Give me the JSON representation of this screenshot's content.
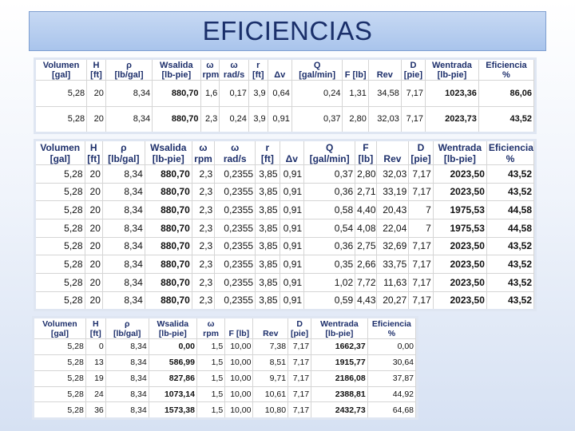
{
  "title": "EFICIENCIAS",
  "table1": {
    "head1": [
      "Volumen",
      "H",
      "ρ",
      "Wsalida",
      "ω",
      "ω",
      "r",
      "",
      "Q",
      "",
      "",
      "D",
      "Wentrada",
      "Eficiencia"
    ],
    "head2": [
      "[gal]",
      "[ft]",
      "[lb/gal]",
      "[lb-pie]",
      "rpm",
      "rad/s",
      "[ft]",
      "Δv",
      "[gal/min]",
      "F [lb]",
      "Rev",
      "[pie]",
      "[lb-pie]",
      "%"
    ],
    "rows": [
      [
        "5,28",
        "20",
        "8,34",
        "880,70",
        "1,6",
        "0,17",
        "3,9",
        "0,64",
        "0,24",
        "1,31",
        "34,58",
        "7,17",
        "1023,36",
        "86,06"
      ],
      [
        "5,28",
        "20",
        "8,34",
        "880,70",
        "2,3",
        "0,24",
        "3,9",
        "0,91",
        "0,37",
        "2,80",
        "32,03",
        "7,17",
        "2023,73",
        "43,52"
      ]
    ]
  },
  "table2": {
    "head1": [
      "Volumen",
      "H",
      "ρ",
      "Wsalida",
      "ω",
      "ω",
      "r",
      "",
      "Q",
      "F",
      "",
      "D",
      "Wentrada",
      "Eficiencia"
    ],
    "head2": [
      "[gal]",
      "[ft]",
      "[lb/gal]",
      "[lb-pie]",
      "rpm",
      "rad/s",
      "[ft]",
      "Δv",
      "[gal/min]",
      "[lb]",
      "Rev",
      "[pie]",
      "[lb-pie]",
      "%"
    ],
    "rows": [
      [
        "5,28",
        "20",
        "8,34",
        "880,70",
        "2,3",
        "0,2355",
        "3,85",
        "0,91",
        "0,37",
        "2,80",
        "32,03",
        "7,17",
        "2023,50",
        "43,52"
      ],
      [
        "5,28",
        "20",
        "8,34",
        "880,70",
        "2,3",
        "0,2355",
        "3,85",
        "0,91",
        "0,36",
        "2,71",
        "33,19",
        "7,17",
        "2023,50",
        "43,52"
      ],
      [
        "5,28",
        "20",
        "8,34",
        "880,70",
        "2,3",
        "0,2355",
        "3,85",
        "0,91",
        "0,58",
        "4,40",
        "20,43",
        "7",
        "1975,53",
        "44,58"
      ],
      [
        "5,28",
        "20",
        "8,34",
        "880,70",
        "2,3",
        "0,2355",
        "3,85",
        "0,91",
        "0,54",
        "4,08",
        "22,04",
        "7",
        "1975,53",
        "44,58"
      ],
      [
        "5,28",
        "20",
        "8,34",
        "880,70",
        "2,3",
        "0,2355",
        "3,85",
        "0,91",
        "0,36",
        "2,75",
        "32,69",
        "7,17",
        "2023,50",
        "43,52"
      ],
      [
        "5,28",
        "20",
        "8,34",
        "880,70",
        "2,3",
        "0,2355",
        "3,85",
        "0,91",
        "0,35",
        "2,66",
        "33,75",
        "7,17",
        "2023,50",
        "43,52"
      ],
      [
        "5,28",
        "20",
        "8,34",
        "880,70",
        "2,3",
        "0,2355",
        "3,85",
        "0,91",
        "1,02",
        "7,72",
        "11,63",
        "7,17",
        "2023,50",
        "43,52"
      ],
      [
        "5,28",
        "20",
        "8,34",
        "880,70",
        "2,3",
        "0,2355",
        "3,85",
        "0,91",
        "0,59",
        "4,43",
        "20,27",
        "7,17",
        "2023,50",
        "43,52"
      ]
    ]
  },
  "table3": {
    "head1": [
      "Volumen",
      "H",
      "ρ",
      "Wsalida",
      "ω",
      "",
      "",
      "D",
      "Wentrada",
      "Eficiencia"
    ],
    "head2": [
      "[gal]",
      "[ft]",
      "[lb/gal]",
      "[lb-pie]",
      "rpm",
      "F [lb]",
      "Rev",
      "[pie]",
      "[lb-pie]",
      "%"
    ],
    "rows": [
      [
        "5,28",
        "0",
        "8,34",
        "0,00",
        "1,5",
        "10,00",
        "7,38",
        "7,17",
        "1662,37",
        "0,00"
      ],
      [
        "5,28",
        "13",
        "8,34",
        "586,99",
        "1,5",
        "10,00",
        "8,51",
        "7,17",
        "1915,77",
        "30,64"
      ],
      [
        "5,28",
        "19",
        "8,34",
        "827,86",
        "1,5",
        "10,00",
        "9,71",
        "7,17",
        "2186,08",
        "37,87"
      ],
      [
        "5,28",
        "24",
        "8,34",
        "1073,14",
        "1,5",
        "10,00",
        "10,61",
        "7,17",
        "2388,81",
        "44,92"
      ],
      [
        "5,28",
        "36",
        "8,34",
        "1573,38",
        "1,5",
        "10,00",
        "10,80",
        "7,17",
        "2432,73",
        "64,68"
      ]
    ]
  }
}
